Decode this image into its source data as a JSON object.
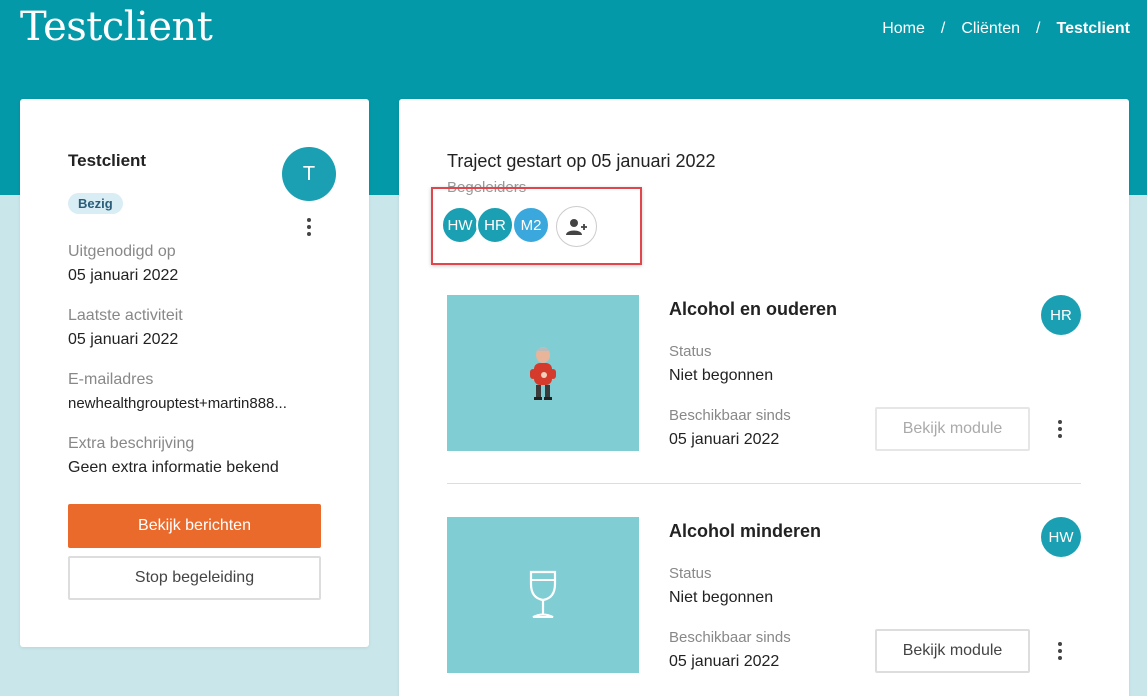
{
  "page": {
    "title": "Testclient"
  },
  "breadcrumb": {
    "home": "Home",
    "clients": "Cliënten",
    "current": "Testclient",
    "separator": "/"
  },
  "client": {
    "name": "Testclient",
    "avatar_initial": "T",
    "status_badge": "Bezig",
    "fields": [
      {
        "label": "Uitgenodigd op",
        "value": "05 januari 2022"
      },
      {
        "label": "Laatste activiteit",
        "value": "05 januari 2022"
      },
      {
        "label": "E-mailadres",
        "value": "newhealthgrouptest+martin888..."
      },
      {
        "label": "Extra beschrijving",
        "value": "Geen extra informatie bekend"
      }
    ],
    "primary_button": "Bekijk berichten",
    "secondary_button": "Stop begeleiding"
  },
  "traject": {
    "title": "Traject gestart op 05 januari 2022",
    "begeleiders_label": "Begeleiders",
    "begeleiders": [
      {
        "initials": "HW",
        "color": "#1aa0b2"
      },
      {
        "initials": "HR",
        "color": "#1aa0b2"
      },
      {
        "initials": "M2",
        "color": "#3aa8dc"
      }
    ],
    "add_icon": "add-person-icon"
  },
  "modules": [
    {
      "title": "Alcohol en ouderen",
      "assignee": "HR",
      "status_label": "Status",
      "status_value": "Niet begonnen",
      "available_label": "Beschikbaar sinds",
      "available_value": "05 januari 2022",
      "button": "Bekijk module",
      "button_disabled": true,
      "illustration": "elderly-man-illustration"
    },
    {
      "title": "Alcohol minderen",
      "assignee": "HW",
      "status_label": "Status",
      "status_value": "Niet begonnen",
      "available_label": "Beschikbaar sinds",
      "available_value": "05 januari 2022",
      "button": "Bekijk module",
      "button_disabled": false,
      "illustration": "wine-glass-icon"
    }
  ],
  "colors": {
    "header": "#0399a8",
    "accent": "#1aa0b2",
    "primary_button": "#ea6a2c",
    "highlight": "#e0474c"
  }
}
